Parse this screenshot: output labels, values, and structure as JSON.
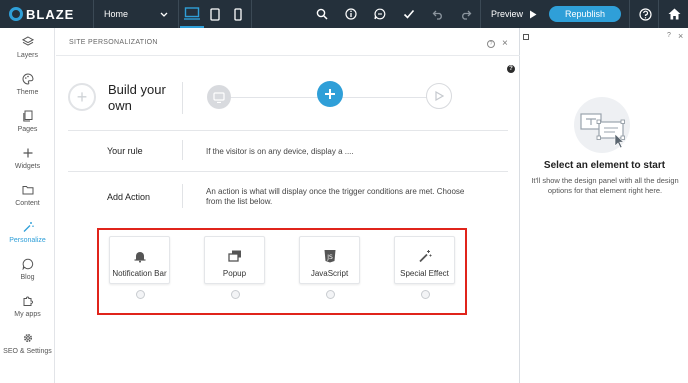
{
  "topbar": {
    "logo_text": "BLAZE",
    "page_select": "Home",
    "preview_label": "Preview",
    "republish_label": "Republish"
  },
  "sidebar": {
    "items": [
      {
        "label": "Layers",
        "icon": "layers-icon"
      },
      {
        "label": "Theme",
        "icon": "palette-icon"
      },
      {
        "label": "Pages",
        "icon": "pages-icon"
      },
      {
        "label": "Widgets",
        "icon": "plus-icon"
      },
      {
        "label": "Content",
        "icon": "folder-icon"
      },
      {
        "label": "Personalize",
        "icon": "wand-icon",
        "active": true
      },
      {
        "label": "Blog",
        "icon": "chat-icon"
      },
      {
        "label": "My apps",
        "icon": "puzzle-icon"
      },
      {
        "label": "SEO & Settings",
        "icon": "gear-icon"
      }
    ]
  },
  "panel": {
    "title": "SITE PERSONALIZATION",
    "build_title": "Build your own",
    "your_rule_label": "Your rule",
    "your_rule_text": "If the visitor is on any device, display a ....",
    "add_action_label": "Add Action",
    "add_action_text": "An action is what will display once the trigger conditions are met. Choose from the list below.",
    "actions": [
      {
        "label": "Notification Bar",
        "icon": "notification-bar-icon"
      },
      {
        "label": "Popup",
        "icon": "popup-icon"
      },
      {
        "label": "JavaScript",
        "icon": "javascript-icon"
      },
      {
        "label": "Special Effect",
        "icon": "magic-wand-icon"
      }
    ]
  },
  "right_panel": {
    "title": "Select an element to start",
    "description": "It'll show the design panel with all the design options for that element right here."
  },
  "colors": {
    "topbar_bg": "#24303b",
    "accent": "#2f9fd8",
    "highlight_box": "#e0241b"
  }
}
